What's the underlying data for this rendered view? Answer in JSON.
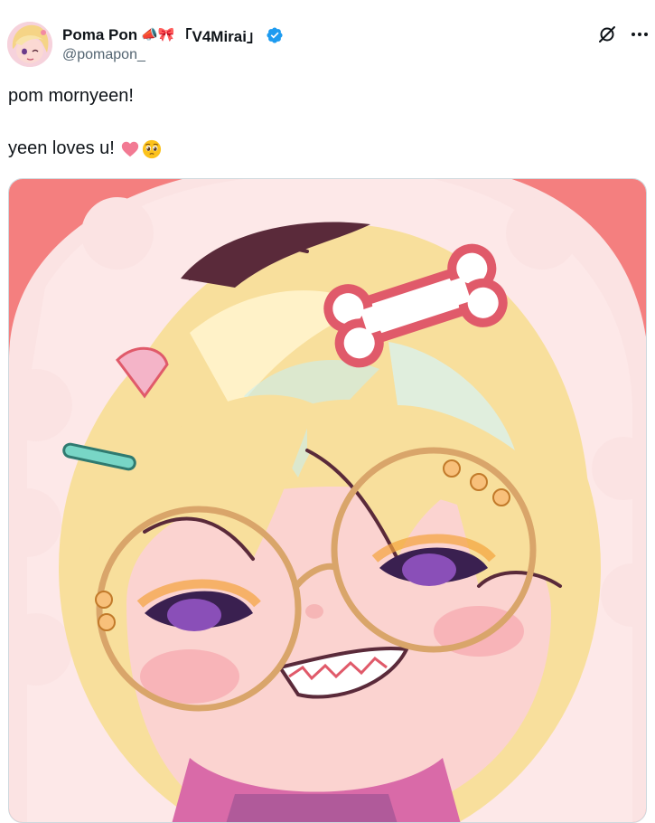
{
  "author": {
    "display_name": "Poma Pon",
    "name_emojis": "📣🎀",
    "name_tag": "「V4Mirai」",
    "handle": "@pomapon_",
    "verified": true,
    "avatar_icon": "avatar-image"
  },
  "actions": {
    "grok_icon": "grok-icon",
    "more_icon": "more-options-icon"
  },
  "tweet": {
    "line1": "pom mornyeen!",
    "line2": "yeen loves u!",
    "line2_emojis": [
      "pink-heart-emoji",
      "pleading-face-emoji"
    ]
  },
  "media": {
    "type": "illustration",
    "subject": "blonde anime character with round glasses and bone hair clip",
    "colors": {
      "background": "#f47f7f",
      "fur": "#fbe3e3",
      "hair": "#f8df9c",
      "skin": "#fbd3d0",
      "outline": "#5a2a3a",
      "glasses": "#d9a56a"
    }
  },
  "colors": {
    "verified_blue": "#1d9bf0",
    "text_primary": "#0f1419",
    "text_secondary": "#536471",
    "border": "#cfd9de"
  }
}
